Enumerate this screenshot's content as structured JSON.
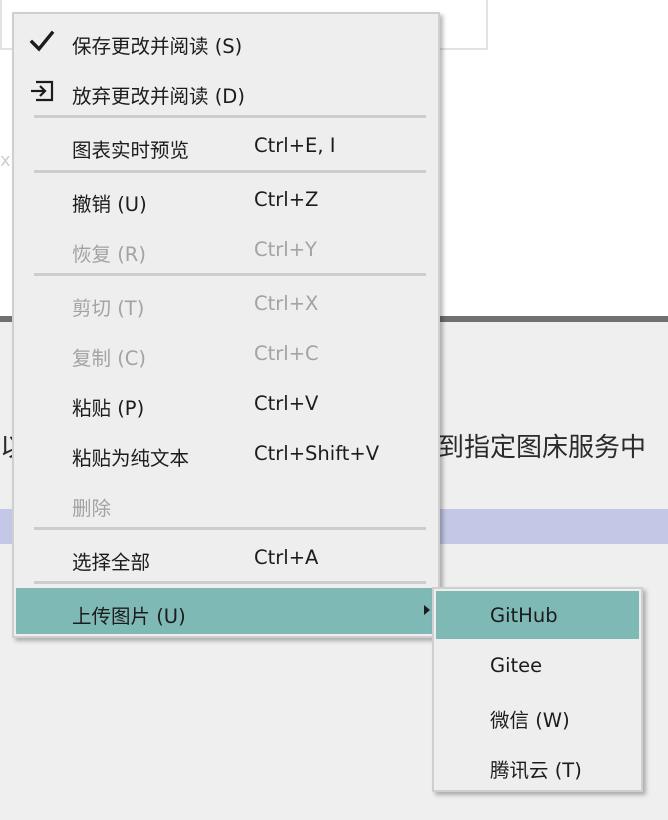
{
  "background": {
    "fragment_x": "x",
    "fragment_left": "以",
    "fragment_right": "到指定图床服务中"
  },
  "context_menu": {
    "items": [
      {
        "label": "保存更改并阅读 (S)",
        "icon": "checkmark-icon"
      },
      {
        "label": "放弃更改并阅读 (D)",
        "icon": "exit-arrow-icon"
      },
      {
        "label": "图表实时预览",
        "accel": "Ctrl+E, I"
      },
      {
        "label": "撤销 (U)",
        "accel": "Ctrl+Z"
      },
      {
        "label": "恢复 (R)",
        "accel": "Ctrl+Y",
        "disabled": true
      },
      {
        "label": "剪切 (T)",
        "accel": "Ctrl+X",
        "disabled": true
      },
      {
        "label": "复制 (C)",
        "accel": "Ctrl+C",
        "disabled": true
      },
      {
        "label": "粘贴 (P)",
        "accel": "Ctrl+V"
      },
      {
        "label": "粘贴为纯文本",
        "accel": "Ctrl+Shift+V"
      },
      {
        "label": "删除",
        "disabled": true
      },
      {
        "label": "选择全部",
        "accel": "Ctrl+A"
      },
      {
        "label": "上传图片 (U)",
        "has_submenu": true,
        "highlighted": true
      }
    ]
  },
  "upload_submenu": {
    "items": [
      {
        "label": "GitHub",
        "highlighted": true
      },
      {
        "label": "Gitee"
      },
      {
        "label": "微信 (W)"
      },
      {
        "label": "腾讯云 (T)"
      }
    ]
  },
  "colors": {
    "highlight": "#7fb9b6",
    "disabled_text": "#a3a3a3",
    "menu_bg": "#eeeeee",
    "selection_band": "#c4c7e6"
  }
}
